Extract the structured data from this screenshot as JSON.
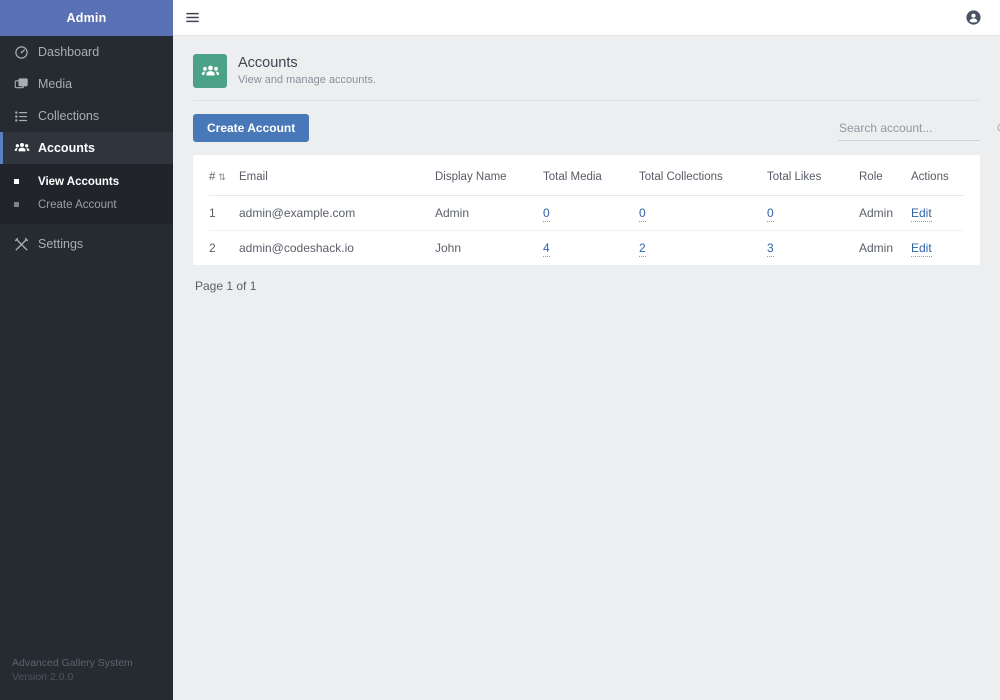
{
  "sidebar": {
    "brand": "Admin",
    "items": [
      {
        "label": "Dashboard",
        "icon": "dashboard-icon",
        "active": false
      },
      {
        "label": "Media",
        "icon": "media-icon",
        "active": false
      },
      {
        "label": "Collections",
        "icon": "collections-icon",
        "active": false
      },
      {
        "label": "Accounts",
        "icon": "accounts-icon",
        "active": true
      },
      {
        "label": "Settings",
        "icon": "settings-icon",
        "active": false
      }
    ],
    "submenu": [
      {
        "label": "View Accounts",
        "active": true
      },
      {
        "label": "Create Account",
        "active": false
      }
    ],
    "footer": {
      "app_name": "Advanced Gallery System",
      "version": "Version 2.0.0"
    },
    "colors": {
      "brand_bg": "#5a71b5",
      "bg": "#262a31",
      "active_bg": "#30343c",
      "active_accent": "#5a7fc4",
      "submenu_bg": "#21252b"
    }
  },
  "topbar": {
    "menu_icon": "hamburger-icon",
    "account_icon": "user-circle-icon"
  },
  "page": {
    "icon": "accounts-group-icon",
    "icon_color": "#4ca287",
    "title": "Accounts",
    "subtitle": "View and manage accounts."
  },
  "toolbar": {
    "create_label": "Create Account",
    "create_color": "#4878b8",
    "search_placeholder": "Search account...",
    "search_value": "",
    "search_icon": "search-icon"
  },
  "table": {
    "columns": [
      {
        "label": "#",
        "sort": "⇅"
      },
      {
        "label": "Email"
      },
      {
        "label": "Display Name"
      },
      {
        "label": "Total Media"
      },
      {
        "label": "Total Collections"
      },
      {
        "label": "Total Likes"
      },
      {
        "label": "Role"
      },
      {
        "label": "Actions"
      }
    ],
    "rows": [
      {
        "num": "1",
        "email": "admin@example.com",
        "display_name": "Admin",
        "total_media": "0",
        "total_collections": "0",
        "total_likes": "0",
        "role": "Admin",
        "action": "Edit"
      },
      {
        "num": "2",
        "email": "admin@codeshack.io",
        "display_name": "John",
        "total_media": "4",
        "total_collections": "2",
        "total_likes": "3",
        "role": "Admin",
        "action": "Edit"
      }
    ],
    "link_color": "#2f63a8"
  },
  "pagination": {
    "text": "Page 1 of 1"
  }
}
